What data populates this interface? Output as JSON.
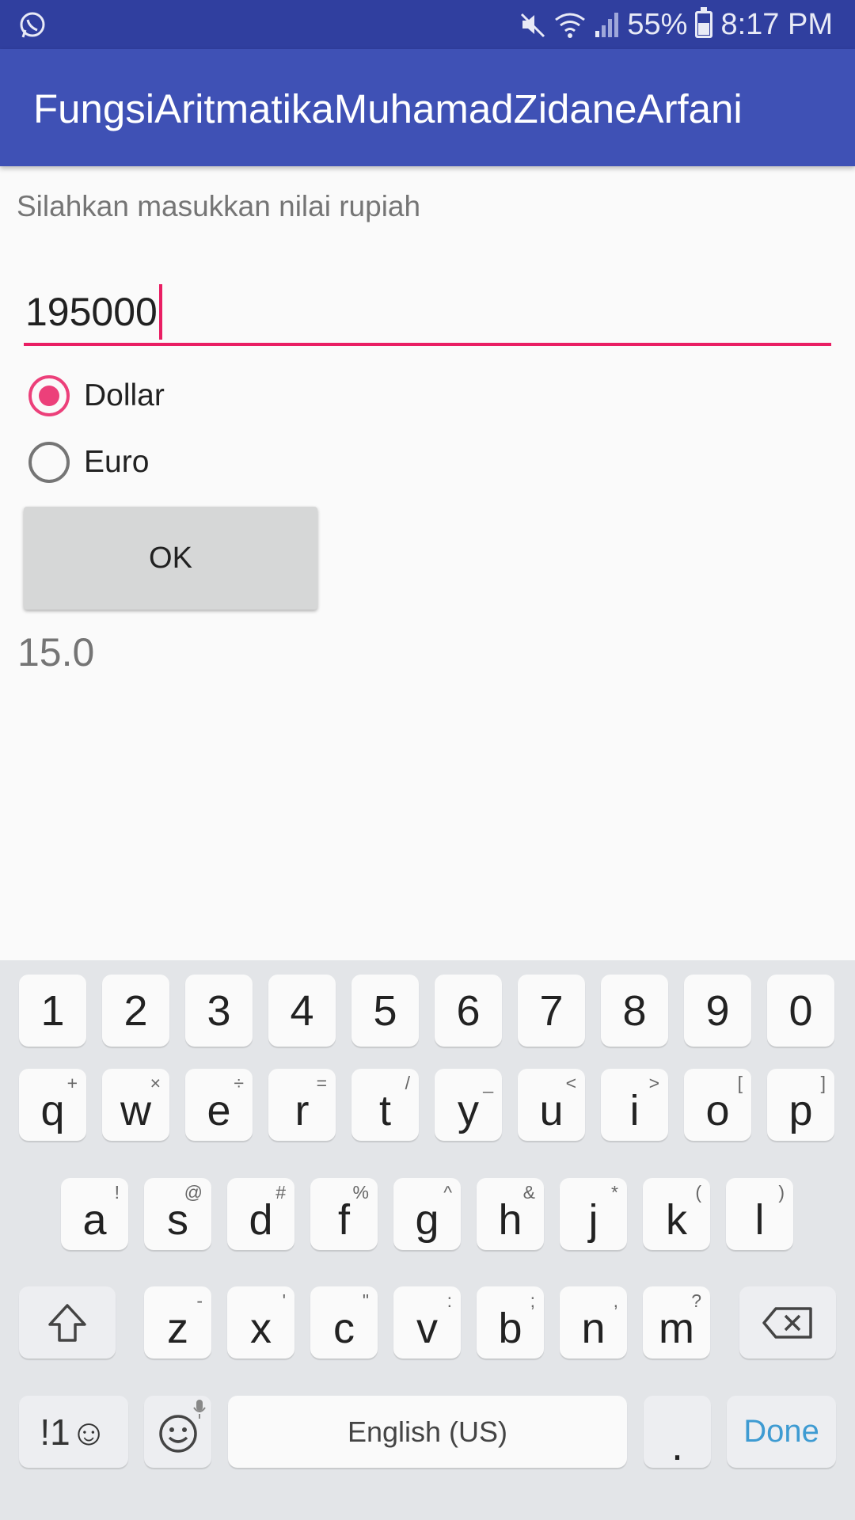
{
  "status_bar": {
    "left_icon": "whatsapp-icon",
    "icons": [
      "mute-icon",
      "wifi-icon",
      "signal-icon"
    ],
    "battery": "55%",
    "time": "8:17 PM"
  },
  "app_bar": {
    "title": "FungsiAritmatikaMuhamadZidaneArfani"
  },
  "form": {
    "prompt": "Silahkan masukkan nilai rupiah",
    "input_value": "195000",
    "options": [
      {
        "label": "Dollar",
        "checked": true
      },
      {
        "label": "Euro",
        "checked": false
      }
    ],
    "ok_label": "OK",
    "result": "15.0"
  },
  "keyboard": {
    "row_numbers": [
      "1",
      "2",
      "3",
      "4",
      "5",
      "6",
      "7",
      "8",
      "9",
      "0"
    ],
    "row_top": [
      {
        "k": "q",
        "h": "+"
      },
      {
        "k": "w",
        "h": "×"
      },
      {
        "k": "e",
        "h": "÷"
      },
      {
        "k": "r",
        "h": "="
      },
      {
        "k": "t",
        "h": "/"
      },
      {
        "k": "y",
        "h": "_"
      },
      {
        "k": "u",
        "h": "<"
      },
      {
        "k": "i",
        "h": ">"
      },
      {
        "k": "o",
        "h": "["
      },
      {
        "k": "p",
        "h": "]"
      }
    ],
    "row_middle": [
      {
        "k": "a",
        "h": "!"
      },
      {
        "k": "s",
        "h": "@"
      },
      {
        "k": "d",
        "h": "#"
      },
      {
        "k": "f",
        "h": "%"
      },
      {
        "k": "g",
        "h": "^"
      },
      {
        "k": "h",
        "h": "&"
      },
      {
        "k": "j",
        "h": "*"
      },
      {
        "k": "k",
        "h": "("
      },
      {
        "k": "l",
        "h": ")"
      }
    ],
    "row_bottom": [
      {
        "k": "z",
        "h": "-"
      },
      {
        "k": "x",
        "h": "'"
      },
      {
        "k": "c",
        "h": "\""
      },
      {
        "k": "v",
        "h": ":"
      },
      {
        "k": "b",
        "h": ";"
      },
      {
        "k": "n",
        "h": ","
      },
      {
        "k": "m",
        "h": "?"
      }
    ],
    "shift_icon": "shift-icon",
    "backspace_icon": "backspace-icon",
    "symbols_label": "!1☺",
    "emoji_icon": "emoji-icon",
    "space_label": "English (US)",
    "period_label": ".",
    "done_label": "Done",
    "accent": "#3e9bd2"
  },
  "colors": {
    "primary": "#3f51b5",
    "primary_dark": "#303f9f",
    "accent": "#e91e63"
  }
}
